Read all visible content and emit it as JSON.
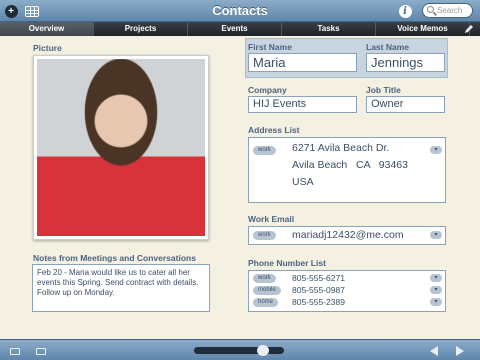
{
  "app": {
    "title": "Contacts",
    "search_placeholder": "Search"
  },
  "tabs": [
    {
      "label": "Overview",
      "active": true
    },
    {
      "label": "Projects",
      "active": false
    },
    {
      "label": "Events",
      "active": false
    },
    {
      "label": "Tasks",
      "active": false
    },
    {
      "label": "Voice Memos",
      "active": false
    }
  ],
  "picture": {
    "label": "Picture"
  },
  "notes": {
    "label": "Notes from Meetings and Conversations",
    "text": "Feb 20 - Maria would like us to cater all her events this Spring. Send contract with details. Follow up on Monday."
  },
  "contact": {
    "first_name_label": "First Name",
    "first_name": "Maria",
    "last_name_label": "Last Name",
    "last_name": "Jennings",
    "company_label": "Company",
    "company": "HIJ Events",
    "job_title_label": "Job Title",
    "job_title": "Owner"
  },
  "address": {
    "label": "Address List",
    "type": "work",
    "line1": "6271 Avila Beach Dr.",
    "line2": "Avila Beach   CA   93463",
    "line3": "USA"
  },
  "email": {
    "label": "Work Email",
    "type": "work",
    "value": "mariadj12432@me.com"
  },
  "phones": {
    "label": "Phone Number List",
    "items": [
      {
        "type": "work",
        "number": "805-555-6271"
      },
      {
        "type": "mobile",
        "number": "805-555-0987"
      },
      {
        "type": "home",
        "number": "805-555-2389"
      }
    ]
  },
  "icons": {
    "add": "add-circle-icon",
    "grid": "grid-view-icon",
    "info": "info-icon",
    "search": "search-icon",
    "edit": "pencil-icon"
  },
  "colors": {
    "bar_blue": "#6f93b6",
    "tab_dark": "#2a2e33",
    "label_blue": "#4c6480",
    "field_text": "#3b4f66",
    "background": "#f4f0e2"
  }
}
